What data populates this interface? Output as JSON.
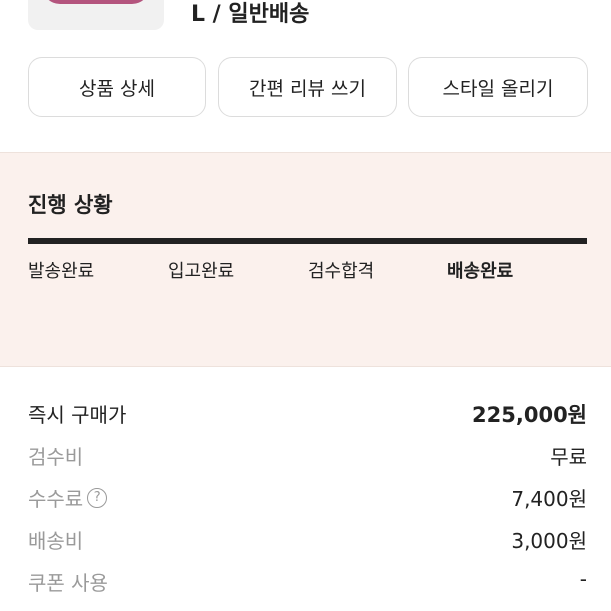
{
  "product": {
    "option_text": "L / 일반배송",
    "image_icon": "sweatshirt-thumbnail"
  },
  "actions": {
    "detail_label": "상품 상세",
    "review_label": "간편 리뷰 쓰기",
    "style_label": "스타일 올리기"
  },
  "progress": {
    "title": "진행 상황",
    "steps": [
      "발송완료",
      "입고완료",
      "검수합격",
      "배송완료"
    ],
    "current_step": "배송완료",
    "fill_fraction": 1.0,
    "background_color": "#fbf1ed"
  },
  "pricing": {
    "rows": [
      {
        "label": "즉시 구매가",
        "value": "225,000원"
      },
      {
        "label": "검수비",
        "value": "무료"
      },
      {
        "label": "수수료",
        "value": "7,400원",
        "help_icon": "question-circle-icon",
        "help_glyph": "?"
      },
      {
        "label": "배송비",
        "value": "3,000원"
      },
      {
        "label": "쿠폰 사용",
        "value": "-"
      }
    ]
  }
}
